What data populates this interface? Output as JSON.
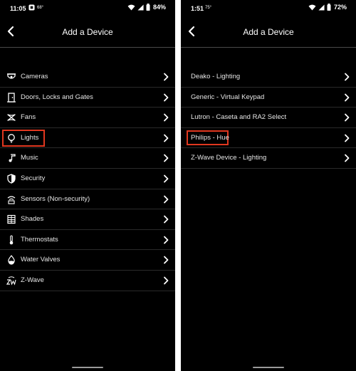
{
  "left": {
    "status": {
      "time": "11:05",
      "temp": "68°",
      "battery": "84%"
    },
    "title": "Add a Device",
    "items": [
      {
        "label": "Cameras",
        "icon": "camera-icon"
      },
      {
        "label": "Doors, Locks and Gates",
        "icon": "door-icon"
      },
      {
        "label": "Fans",
        "icon": "fan-icon"
      },
      {
        "label": "Lights",
        "icon": "lightbulb-icon",
        "highlighted": true
      },
      {
        "label": "Music",
        "icon": "music-note-icon"
      },
      {
        "label": "Security",
        "icon": "shield-icon"
      },
      {
        "label": "Sensors (Non-security)",
        "icon": "sensor-icon"
      },
      {
        "label": "Shades",
        "icon": "shades-icon"
      },
      {
        "label": "Thermostats",
        "icon": "thermometer-icon"
      },
      {
        "label": "Water Valves",
        "icon": "water-drop-icon"
      },
      {
        "label": "Z-Wave",
        "icon": "zwave-icon"
      }
    ]
  },
  "right": {
    "status": {
      "time": "1:51",
      "temp": "75°",
      "battery": "72%"
    },
    "title": "Add a Device",
    "items": [
      {
        "label": "Deako - Lighting"
      },
      {
        "label": "Generic - Virtual Keypad"
      },
      {
        "label": "Lutron - Caseta and RA2 Select"
      },
      {
        "label": "Philips - Hue",
        "highlighted": true
      },
      {
        "label": "Z-Wave Device - Lighting"
      }
    ]
  },
  "colors": {
    "background": "#000000",
    "text": "#ffffff",
    "highlight": "#e0371f",
    "divider": "#2a2a2a"
  }
}
